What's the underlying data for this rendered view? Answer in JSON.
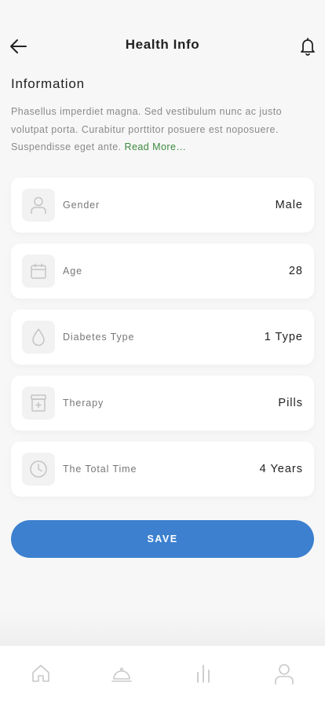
{
  "header": {
    "title": "Health Info",
    "back_icon": "arrow-left-icon",
    "notification_icon": "bell-icon"
  },
  "info": {
    "title": "Information",
    "description": "Phasellus imperdiet magna. Sed vestibulum nunc ac justo volutpat porta. Curabitur porttitor posuere est noposuere. Suspendisse eget ante.",
    "read_more": "Read More…"
  },
  "fields": [
    {
      "label": "Gender",
      "value": "Male",
      "icon": "user-icon"
    },
    {
      "label": "Age",
      "value": "28",
      "icon": "calendar-icon"
    },
    {
      "label": "Diabetes Type",
      "value": "1 Type",
      "icon": "drop-icon"
    },
    {
      "label": "Therapy",
      "value": "Pills",
      "icon": "pill-bottle-icon"
    },
    {
      "label": "The Total Time",
      "value": "4 Years",
      "icon": "clock-icon"
    }
  ],
  "save_label": "SAVE",
  "tabbar": {
    "items": [
      {
        "icon": "home-icon"
      },
      {
        "icon": "food-cloche-icon"
      },
      {
        "icon": "stats-icon"
      },
      {
        "icon": "profile-icon"
      }
    ]
  },
  "colors": {
    "accent": "#3c80cf",
    "link": "#3d8a3e",
    "background": "#f7f7f7"
  }
}
